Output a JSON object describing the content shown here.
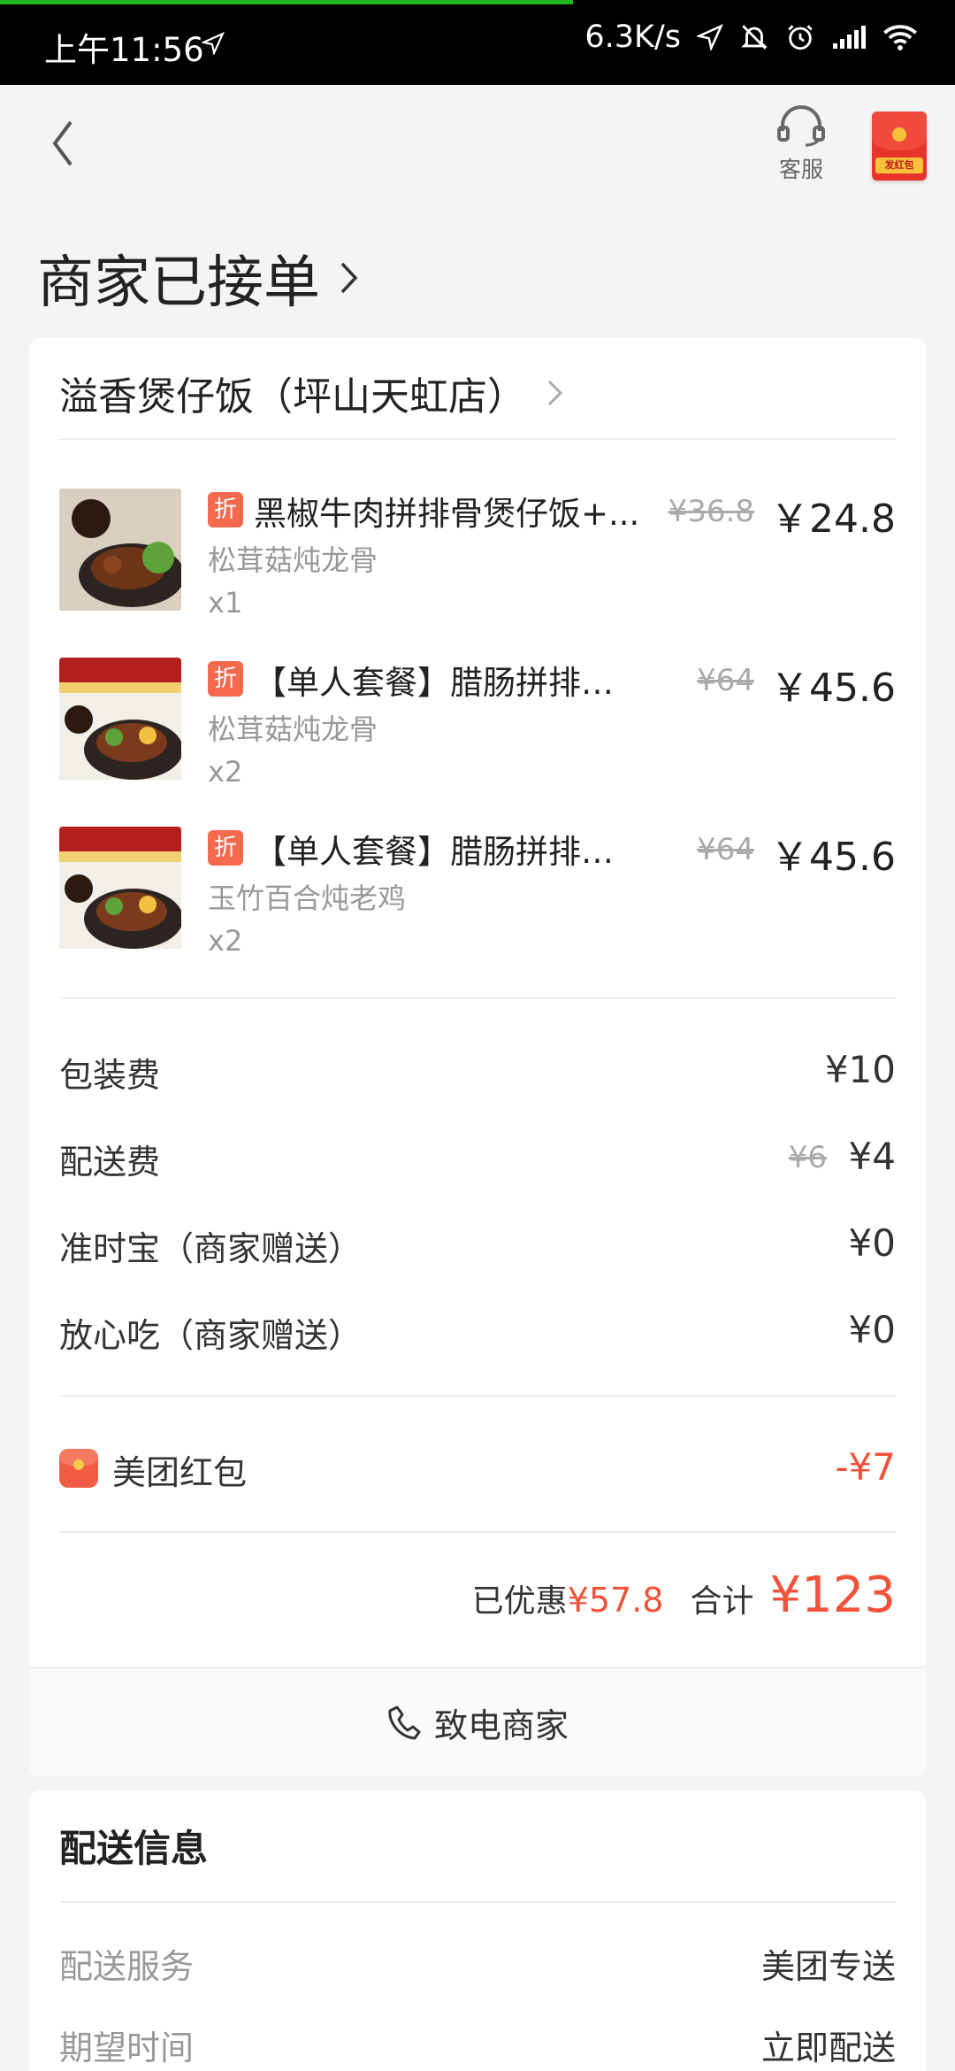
{
  "status_bar": {
    "time": "上午11:56",
    "speed": "6.3K/s"
  },
  "header": {
    "service_label": "客服",
    "red_packet_label": "发红包"
  },
  "order_status": "商家已接单",
  "store": {
    "name": "溢香煲仔饭（坪山天虹店）"
  },
  "items": [
    {
      "discount_tag": "折",
      "name": "黑椒牛肉拼排骨煲仔饭+...",
      "original_price": "¥36.8",
      "price": "￥24.8",
      "spec": "松茸菇炖龙骨",
      "qty": "x1"
    },
    {
      "discount_tag": "折",
      "name": "【单人套餐】腊肠拼排骨...",
      "original_price": "¥64",
      "price": "￥45.6",
      "spec": "松茸菇炖龙骨",
      "qty": "x2"
    },
    {
      "discount_tag": "折",
      "name": "【单人套餐】腊肠拼排骨...",
      "original_price": "¥64",
      "price": "￥45.6",
      "spec": "玉竹百合炖老鸡",
      "qty": "x2"
    }
  ],
  "fees": {
    "packaging": {
      "label": "包装费",
      "value": "¥10"
    },
    "delivery": {
      "label": "配送费",
      "original": "¥6",
      "value": "¥4"
    },
    "ontime": {
      "label": "准时宝（商家赠送）",
      "value": "¥0"
    },
    "safe": {
      "label": "放心吃（商家赠送）",
      "value": "¥0"
    }
  },
  "red_packet": {
    "label": "美团红包",
    "value": "-¥7"
  },
  "totals": {
    "saved_label": "已优惠",
    "saved_value": "¥57.8",
    "sum_label": "合计",
    "sum_value": "¥123"
  },
  "call_merchant": "致电商家",
  "delivery_info": {
    "title": "配送信息",
    "rows": [
      {
        "label": "配送服务",
        "value": "美团专送"
      },
      {
        "label": "期望时间",
        "value": "立即配送"
      }
    ]
  },
  "colors": {
    "accent_red": "#f2513a",
    "discount_tag": "#f5694f",
    "progress_green": "#22b522"
  }
}
